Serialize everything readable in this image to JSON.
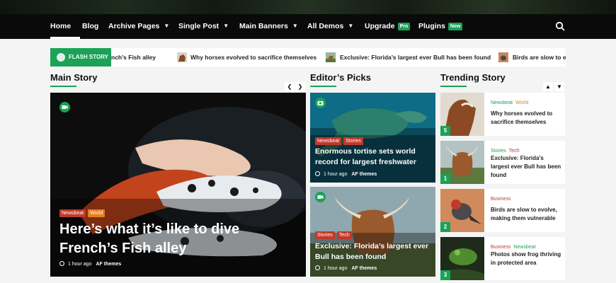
{
  "nav": {
    "items": [
      {
        "label": "Home"
      },
      {
        "label": "Blog"
      },
      {
        "label": "Archive Pages"
      },
      {
        "label": "Single Post"
      },
      {
        "label": "Main Banners"
      },
      {
        "label": "All Demos"
      },
      {
        "label": "Upgrade",
        "badge": "Pro"
      },
      {
        "label": "Plugins",
        "badge": "New"
      }
    ],
    "search_icon": "search-icon"
  },
  "ticker": {
    "label": "FLASH STORY",
    "items": [
      "nch’s Fish alley",
      "Why horses evolved to sacrifice themselves",
      "Exclusive: Florida’s largest ever Bull has been found",
      "Birds are slow to evo"
    ]
  },
  "sections": {
    "main_story": "Main Story",
    "editors_picks": "Editor’s Picks",
    "trending_story": "Trending Story"
  },
  "main": {
    "categories": [
      "Newsbeat",
      "World"
    ],
    "title": "Here’s what it’s like to dive French’s Fish alley",
    "time": "1 hour ago",
    "author": "AF themes"
  },
  "editors": [
    {
      "categories": [
        "Newsbeat",
        "Stories"
      ],
      "title": "Enormous tortise sets world record for largest freshwater",
      "time": "1 hour ago",
      "author": "AF themes"
    },
    {
      "categories": [
        "Stories",
        "Tech"
      ],
      "title": "Exclusive: Florida’s largest ever Bull has been found",
      "time": "1 hour ago",
      "author": "AF themes"
    }
  ],
  "trending": [
    {
      "num": "5",
      "categories": [
        "Newsbeat",
        "World"
      ],
      "title": "Why horses evolved to sacrifice themselves"
    },
    {
      "num": "1",
      "categories": [
        "Stories",
        "Tech"
      ],
      "title": "Exclusive: Florida’s largest ever Bull has been found"
    },
    {
      "num": "2",
      "categories": [
        "Business"
      ],
      "title": "Birds are slow to evolve, making them vulnerable"
    },
    {
      "num": "3",
      "categories": [
        "Business",
        "Newsbeat"
      ],
      "title": "Photos show frog thriving in protected area"
    }
  ],
  "colors": {
    "accent": "#1aa257",
    "newsbeat": "#c0392b",
    "world": "#e67e22",
    "stories": "#c0392b",
    "tech": "#c0392b",
    "business": "#c0392b"
  }
}
